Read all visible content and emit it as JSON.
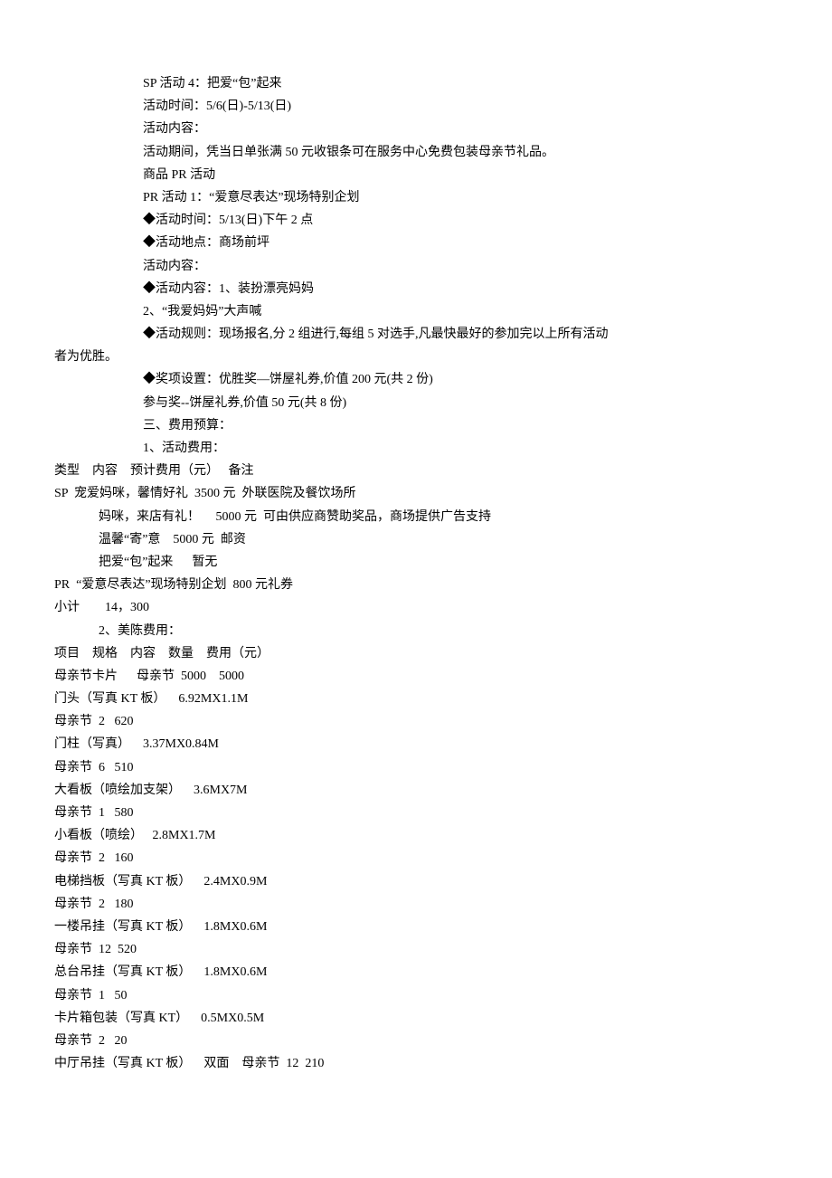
{
  "lines": [
    {
      "cls": "indent1",
      "text": "SP 活动 4：把爱“包”起来"
    },
    {
      "cls": "indent1",
      "text": "活动时间：5/6(日)-5/13(日)"
    },
    {
      "cls": "indent1",
      "text": "活动内容："
    },
    {
      "cls": "indent1",
      "text": "活动期间，凭当日单张满 50 元收银条可在服务中心免费包装母亲节礼品。"
    },
    {
      "cls": "indent1",
      "text": "商品 PR 活动"
    },
    {
      "cls": "indent1",
      "text": "PR 活动 1：“爱意尽表达”现场特别企划"
    },
    {
      "cls": "indent1",
      "text": "◆活动时间：5/13(日)下午 2 点"
    },
    {
      "cls": "indent1",
      "text": "◆活动地点：商场前坪"
    },
    {
      "cls": "indent1",
      "text": "活动内容："
    },
    {
      "cls": "indent1",
      "text": "◆活动内容：1、装扮漂亮妈妈"
    },
    {
      "cls": "indent1",
      "text": "2、“我爱妈妈”大声喊"
    },
    {
      "cls": "indent1",
      "text": "◆活动规则：现场报名,分 2 组进行,每组 5 对选手,凡最快最好的参加完以上所有活动"
    },
    {
      "cls": "noindent",
      "text": "者为优胜。"
    },
    {
      "cls": "indent1",
      "text": "◆奖项设置：优胜奖—饼屋礼券,价值 200 元(共 2 份)"
    },
    {
      "cls": "indent1",
      "text": "参与奖--饼屋礼券,价值 50 元(共 8 份)"
    },
    {
      "cls": "indent1",
      "text": "三、费用预算："
    },
    {
      "cls": "indent1",
      "text": "1、活动费用："
    },
    {
      "cls": "noindent",
      "text": "类型    内容    预计费用（元）   备注"
    },
    {
      "cls": "noindent",
      "text": "SP  宠爱妈咪，馨情好礼  3500 元  外联医院及餐饮场所"
    },
    {
      "cls": "indent2",
      "text": "妈咪，来店有礼！     5000 元  可由供应商赞助奖品，商场提供广告支持"
    },
    {
      "cls": "indent2",
      "text": "温馨“寄”意    5000 元  邮资"
    },
    {
      "cls": "indent2",
      "text": "把爱“包”起来      暂无"
    },
    {
      "cls": "noindent",
      "text": "PR  “爱意尽表达”现场特别企划  800 元礼券"
    },
    {
      "cls": "noindent",
      "text": "小计        14，300"
    },
    {
      "cls": "indent2",
      "text": "2、美陈费用："
    },
    {
      "cls": "noindent",
      "text": "项目    规格    内容    数量    费用（元）"
    },
    {
      "cls": "noindent",
      "text": "母亲节卡片      母亲节  5000    5000"
    },
    {
      "cls": "noindent",
      "text": "门头（写真 KT 板）    6.92MX1.1M"
    },
    {
      "cls": "noindent",
      "text": "母亲节  2   620"
    },
    {
      "cls": "noindent",
      "text": "门柱（写真）    3.37MX0.84M"
    },
    {
      "cls": "noindent",
      "text": "母亲节  6   510"
    },
    {
      "cls": "noindent",
      "text": "大看板（喷绘加支架）    3.6MX7M"
    },
    {
      "cls": "noindent",
      "text": "母亲节  1   580"
    },
    {
      "cls": "noindent",
      "text": "小看板（喷绘）   2.8MX1.7M"
    },
    {
      "cls": "noindent",
      "text": "母亲节  2   160"
    },
    {
      "cls": "noindent",
      "text": "电梯挡板（写真 KT 板）    2.4MX0.9M"
    },
    {
      "cls": "noindent",
      "text": "母亲节  2   180"
    },
    {
      "cls": "noindent",
      "text": "一楼吊挂（写真 KT 板）    1.8MX0.6M"
    },
    {
      "cls": "noindent",
      "text": "母亲节  12  520"
    },
    {
      "cls": "noindent",
      "text": "总台吊挂（写真 KT 板）    1.8MX0.6M"
    },
    {
      "cls": "noindent",
      "text": "母亲节  1   50"
    },
    {
      "cls": "noindent",
      "text": "卡片箱包装（写真 KT）    0.5MX0.5M"
    },
    {
      "cls": "noindent",
      "text": "母亲节  2   20"
    },
    {
      "cls": "noindent",
      "text": "中厅吊挂（写真 KT 板）    双面    母亲节  12  210"
    }
  ]
}
